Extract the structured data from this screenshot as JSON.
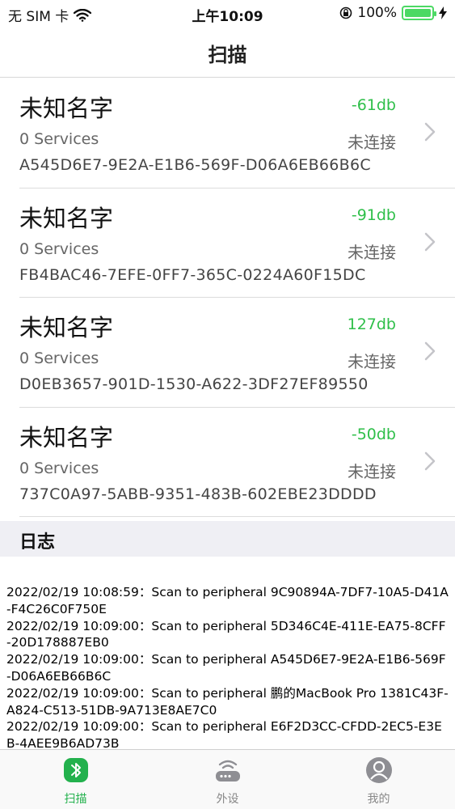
{
  "status_bar": {
    "carrier": "无 SIM 卡",
    "time": "上午10:09",
    "battery_percent": "100%",
    "battery_level": 1.0,
    "wifi_icon": "wifi-icon",
    "lock_icon": "orientation-lock-icon",
    "charging_icon": "charging-bolt-icon"
  },
  "nav": {
    "title": "扫描"
  },
  "devices": [
    {
      "name": "未知名字",
      "rssi": "-61db",
      "services": "0 Services",
      "status": "未连接",
      "uuid": "A545D6E7-9E2A-E1B6-569F-D06A6EB66B6C"
    },
    {
      "name": "未知名字",
      "rssi": "-91db",
      "services": "0 Services",
      "status": "未连接",
      "uuid": "FB4BAC46-7EFE-0FF7-365C-0224A60F15DC"
    },
    {
      "name": "未知名字",
      "rssi": "127db",
      "services": "0 Services",
      "status": "未连接",
      "uuid": "D0EB3657-901D-1530-A622-3DF27EF89550"
    },
    {
      "name": "未知名字",
      "rssi": "-50db",
      "services": "0 Services",
      "status": "未连接",
      "uuid": "737C0A97-5ABB-9351-483B-602EBE23DDDD"
    }
  ],
  "log": {
    "title": "日志",
    "lines": [
      "2022/02/19 10:08:59：Scan to peripheral  9C90894A-7DF7-10A5-D41A-F4C26C0F750E",
      "2022/02/19 10:09:00：Scan to peripheral  5D346C4E-411E-EA75-8CFF-20D178887EB0",
      "2022/02/19 10:09:00：Scan to peripheral  A545D6E7-9E2A-E1B6-569F-D06A6EB66B6C",
      "2022/02/19 10:09:00：Scan to peripheral 鹏的MacBook Pro 1381C43F-A824-C513-51DB-9A713E8AE7C0",
      "2022/02/19 10:09:00：Scan to peripheral  E6F2D3CC-CFDD-2EC5-E3EB-4AEE9B6AD73B"
    ]
  },
  "tabs": [
    {
      "label": "扫描",
      "icon": "bluetooth-icon",
      "active": true
    },
    {
      "label": "外设",
      "icon": "router-icon",
      "active": false
    },
    {
      "label": "我的",
      "icon": "user-icon",
      "active": false
    }
  ],
  "colors": {
    "accent": "#23b14d",
    "rssi": "#2fbf4a",
    "battery": "#4cd964"
  }
}
